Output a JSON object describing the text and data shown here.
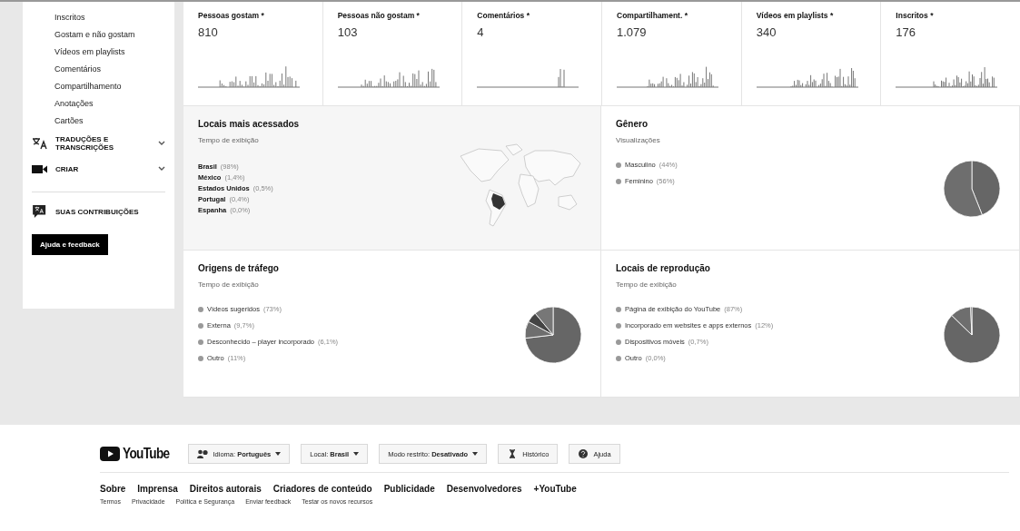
{
  "sidebar": {
    "items": [
      {
        "label": "Inscritos"
      },
      {
        "label": "Gostam e não gostam"
      },
      {
        "label": "Vídeos em playlists"
      },
      {
        "label": "Comentários"
      },
      {
        "label": "Compartilhamento"
      },
      {
        "label": "Anotações"
      },
      {
        "label": "Cartões"
      }
    ],
    "sections": [
      {
        "kind": "translate",
        "label": "TRADUÇÕES E TRANSCRIÇÕES",
        "expanded": false
      },
      {
        "kind": "create",
        "label": "CRIAR",
        "expanded": false
      }
    ],
    "contributions": {
      "label": "SUAS CONTRIBUIÇÕES"
    },
    "help_button": "Ajuda e feedback"
  },
  "stats": [
    {
      "title": "Pessoas gostam *",
      "value": "810"
    },
    {
      "title": "Pessoas não gostam *",
      "value": "103"
    },
    {
      "title": "Comentários *",
      "value": "4"
    },
    {
      "title": "Compartilhament. *",
      "value": "1.079"
    },
    {
      "title": "Vídeos em playlists *",
      "value": "340"
    },
    {
      "title": "Inscritos *",
      "value": "176"
    }
  ],
  "panels": [
    {
      "kind": "map",
      "title": "Locais mais acessados",
      "subtitle": "Tempo de exibição",
      "items": [
        {
          "name": "Brasil",
          "share": "(98%)"
        },
        {
          "name": "México",
          "share": "(1,4%)"
        },
        {
          "name": "Estados Unidos",
          "share": "(0,5%)"
        },
        {
          "name": "Portugal",
          "share": "(0,4%)"
        },
        {
          "name": "Espanha",
          "share": "(0,0%)"
        }
      ]
    },
    {
      "kind": "pie",
      "title": "Gênero",
      "subtitle": "Visualizações",
      "items": [
        {
          "name": "Masculino",
          "share": "(44%)"
        },
        {
          "name": "Feminino",
          "share": "(56%)"
        }
      ],
      "chart_data": {
        "type": "pie",
        "values": [
          44,
          56
        ]
      }
    },
    {
      "kind": "pie",
      "title": "Origens de tráfego",
      "subtitle": "Tempo de exibição",
      "items": [
        {
          "name": "Vídeos sugeridos",
          "share": "(73%)"
        },
        {
          "name": "Externa",
          "share": "(9,7%)"
        },
        {
          "name": "Desconhecido – player incorporado",
          "share": "(6,1%)"
        },
        {
          "name": "Outro",
          "share": "(11%)"
        }
      ],
      "chart_data": {
        "type": "pie",
        "values": [
          73,
          9.7,
          6.1,
          11
        ]
      }
    },
    {
      "kind": "pie",
      "title": "Locais de reprodução",
      "subtitle": "Tempo de exibição",
      "items": [
        {
          "name": "Página de exibição do YouTube",
          "share": "(87%)"
        },
        {
          "name": "Incorporado em websites e apps externos",
          "share": "(12%)"
        },
        {
          "name": "Dispositivos móveis",
          "share": "(0,7%)"
        },
        {
          "name": "Outro",
          "share": "(0,0%)"
        }
      ],
      "chart_data": {
        "type": "pie",
        "values": [
          87,
          12,
          0.7,
          0
        ]
      }
    }
  ],
  "footer": {
    "logo": "YouTube",
    "buttons": [
      {
        "kind": "language",
        "label": "Idioma: **Português**",
        "dropdown": true
      },
      {
        "kind": "plain",
        "label": "Local: **Brasil**",
        "dropdown": true
      },
      {
        "kind": "plain",
        "label": "Modo restrito: **Desativado**",
        "dropdown": true
      },
      {
        "kind": "history",
        "label": "Histórico",
        "dropdown": false
      },
      {
        "kind": "help",
        "label": "Ajuda",
        "dropdown": false
      }
    ],
    "links": [
      "Sobre",
      "Imprensa",
      "Direitos autorais",
      "Criadores de conteúdo",
      "Publicidade",
      "Desenvolvedores",
      "+YouTube"
    ],
    "small_links": [
      "Termos",
      "Privacidade",
      "Política e Segurança",
      "Enviar feedback",
      "Testar os novos recursos"
    ]
  }
}
